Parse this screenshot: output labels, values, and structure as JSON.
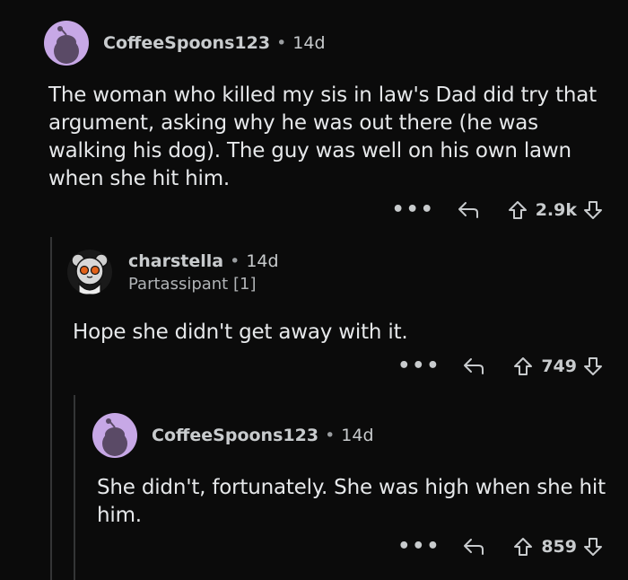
{
  "comments": [
    {
      "username": "CoffeeSpoons123",
      "separator": "•",
      "age": "14d",
      "body": "The woman who killed my sis in law's Dad did try that argument, asking why he was out there (he was walking his dog).  The guy was well on his own lawn when she hit him.",
      "more": "•••",
      "score": "2.9k"
    },
    {
      "username": "charstella",
      "separator": "•",
      "age": "14d",
      "flair": "Partassipant [1]",
      "body": "Hope she didn't get away with it.",
      "more": "•••",
      "score": "749"
    },
    {
      "username": "CoffeeSpoons123",
      "separator": "•",
      "age": "14d",
      "body": "She didn't, fortunately. She was high when she hit him.",
      "more": "•••",
      "score": "859"
    }
  ],
  "colors": {
    "background": "#0b0b0b",
    "avatar_bg": "#c7a8e6",
    "text": "#e6e8ea",
    "thread_line": "#343536"
  }
}
